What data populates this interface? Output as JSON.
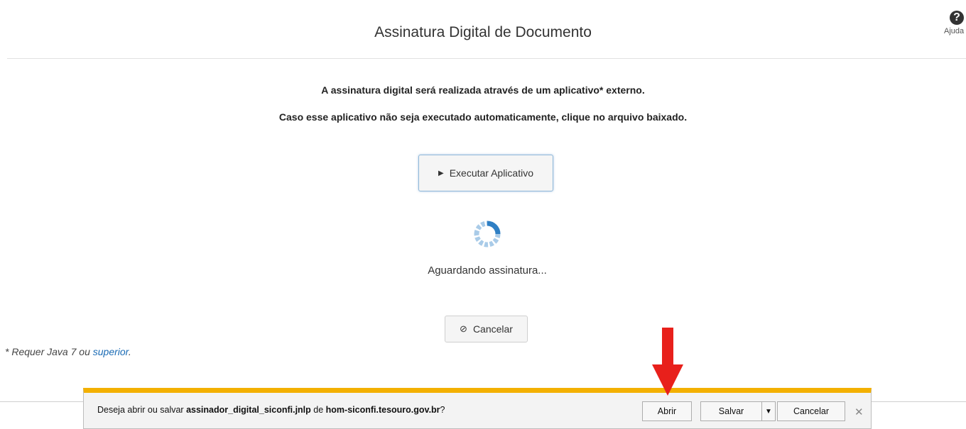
{
  "header": {
    "title": "Assinatura Digital de Documento",
    "help_label": "Ajuda",
    "help_icon": "question-circle-icon"
  },
  "messages": {
    "line1": "A assinatura digital será realizada através de um aplicativo* externo.",
    "line2": "Caso esse aplicativo não seja executado automaticamente, clique no arquivo baixado."
  },
  "actions": {
    "run_label": "Executar Aplicativo",
    "run_icon": "play-icon",
    "cancel_label": "Cancelar",
    "cancel_icon": "ban-icon"
  },
  "status": {
    "waiting_text": "Aguardando assinatura...",
    "spinner_icon": "loading-spinner-icon"
  },
  "footnote": {
    "prefix": "* Requer Java 7 ou ",
    "link": "superior",
    "suffix": "."
  },
  "download_bar": {
    "text_prefix": "Deseja abrir ou salvar ",
    "filename": "assinador_digital_siconfi.jnlp",
    "text_middle": " de ",
    "host": "hom-siconfi.tesouro.gov.br",
    "text_suffix": "?",
    "open_label": "Abrir",
    "save_label": "Salvar",
    "cancel_label": "Cancelar",
    "accent_color": "#f3b000"
  },
  "annotation": {
    "arrow_color": "#e8201b"
  }
}
